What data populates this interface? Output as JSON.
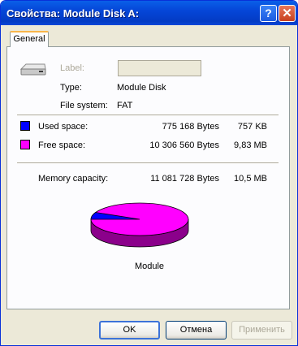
{
  "window": {
    "title": "Свойства: Module Disk A:",
    "help_glyph": "?",
    "close_glyph": "✕"
  },
  "tabs": [
    {
      "label": "General"
    }
  ],
  "general": {
    "label_caption": "Label:",
    "label_value": "",
    "type_caption": "Type:",
    "type_value": "Module Disk",
    "fs_caption": "File system:",
    "fs_value": "FAT",
    "used": {
      "caption": "Used space:",
      "bytes": "775 168 Bytes",
      "short": "757 KB",
      "color": "#0000ff"
    },
    "free": {
      "caption": "Free space:",
      "bytes": "10 306 560 Bytes",
      "short": "9,83 MB",
      "color": "#ff00ff"
    },
    "capacity": {
      "caption": "Memory capacity:",
      "bytes": "11 081 728 Bytes",
      "short": "10,5 MB"
    },
    "pie_caption": "Module",
    "used_fraction": 0.07
  },
  "buttons": {
    "ok": "OK",
    "cancel": "Отмена",
    "apply": "Применить"
  }
}
